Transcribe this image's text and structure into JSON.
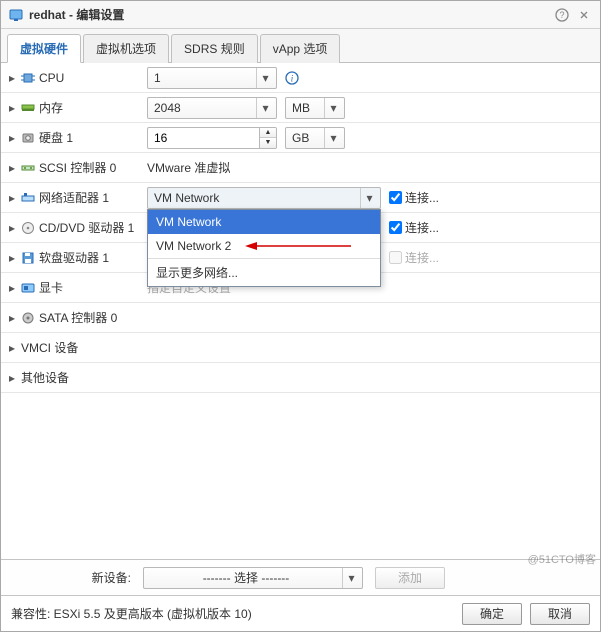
{
  "title": "redhat - 编辑设置",
  "tabs": [
    "虚拟硬件",
    "虚拟机选项",
    "SDRS 规则",
    "vApp 选项"
  ],
  "active_tab_index": 0,
  "hardware": {
    "cpu": {
      "label": "CPU",
      "value": "1"
    },
    "memory": {
      "label": "内存",
      "value": "2048",
      "unit": "MB"
    },
    "disk": {
      "label": "硬盘 1",
      "value": "16",
      "unit": "GB"
    },
    "scsi": {
      "label": "SCSI 控制器 0",
      "value": "VMware 准虚拟"
    },
    "network": {
      "label": "网络适配器 1",
      "value": "VM Network",
      "connect_label": "连接...",
      "options": [
        "VM Network",
        "VM Network 2",
        "显示更多网络..."
      ],
      "selected_index": 0
    },
    "cddvd": {
      "label": "CD/DVD 驱动器 1",
      "connect_label": "连接..."
    },
    "floppy": {
      "label": "软盘驱动器 1",
      "connect_label": "连接..."
    },
    "video": {
      "label": "显卡",
      "partial_text": "指定自定义设置"
    },
    "sata": {
      "label": "SATA 控制器 0"
    },
    "vmci": {
      "label": "VMCI 设备"
    },
    "other": {
      "label": "其他设备"
    }
  },
  "new_device": {
    "label": "新设备:",
    "placeholder": "------- 选择 -------",
    "add_label": "添加"
  },
  "footer": {
    "compat": "兼容性:  ESXi 5.5 及更高版本 (虚拟机版本 10)",
    "ok": "确定",
    "cancel": "取消"
  },
  "watermark": "@51CTO博客"
}
